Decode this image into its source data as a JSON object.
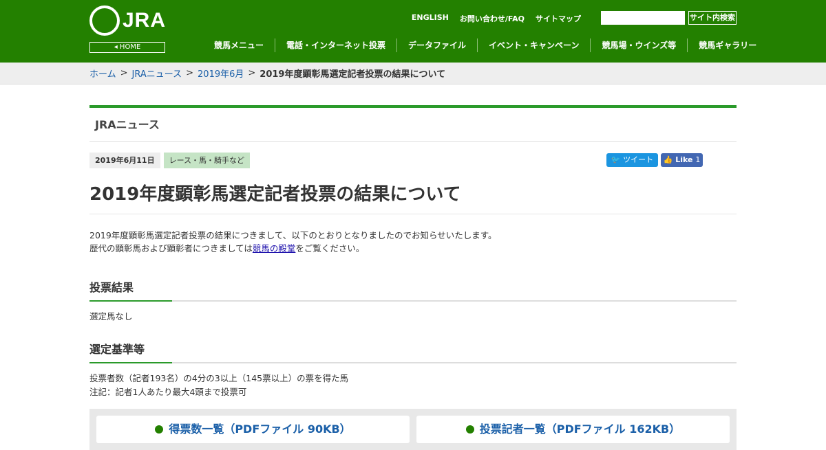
{
  "header": {
    "logo": "JRA",
    "home": "HOME",
    "links": [
      "ENGLISH",
      "お問い合わせ/FAQ",
      "サイトマップ"
    ],
    "search_button": "サイト内検索",
    "search_value": "",
    "nav": [
      "競馬メニュー",
      "電話・インターネット投票",
      "データファイル",
      "イベント・キャンペーン",
      "競馬場・ウインズ等",
      "競馬ギャラリー"
    ]
  },
  "breadcrumb": [
    "ホーム",
    "JRAニュース",
    "2019年6月"
  ],
  "breadcrumb_current": "2019年度顕彰馬選定記者投票の結果について",
  "section": "JRAニュース",
  "meta": {
    "date": "2019年6月11日",
    "category": "レース・馬・騎手など",
    "tweet": "ツイート",
    "like": "Like",
    "like_count": "1"
  },
  "title": "2019年度顕彰馬選定記者投票の結果について",
  "intro": {
    "line1": "2019年度顕彰馬選定記者投票の結果につきまして、以下のとおりとなりましたのでお知らせいたします。",
    "line2a": "歴代の顕彰馬および顕彰者につきましては",
    "link": "競馬の殿堂",
    "line2b": "をご覧ください。"
  },
  "results": {
    "heading": "投票結果",
    "text": "選定馬なし"
  },
  "criteria": {
    "heading": "選定基準等",
    "line1": "投票者数（記者193名）の4分の3以上（145票以上）の票を得た馬",
    "line2": "注記：記者1人あたり最大4頭まで投票可"
  },
  "downloads": [
    "得票数一覧（PDFファイル 90KB）",
    "投票記者一覧（PDFファイル 162KB）"
  ]
}
